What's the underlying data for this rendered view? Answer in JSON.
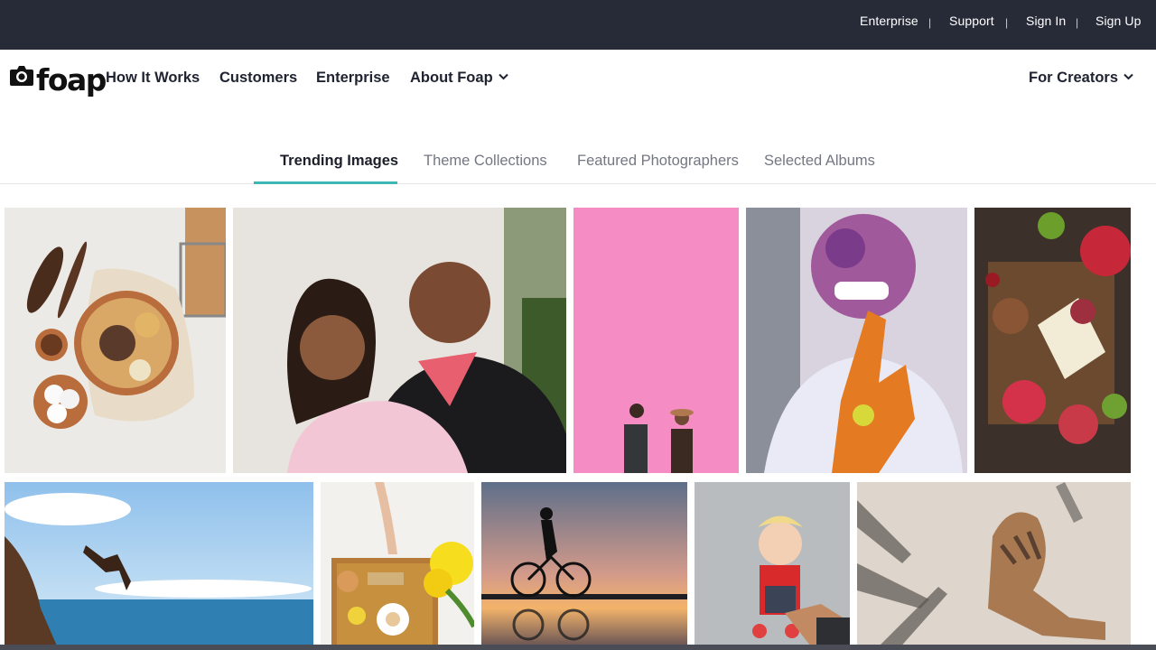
{
  "topbar": {
    "links": [
      "Enterprise",
      "Support",
      "Sign In",
      "Sign Up"
    ],
    "separator": "|"
  },
  "brand": {
    "name": "foap"
  },
  "nav": {
    "items": [
      "How It Works",
      "Customers",
      "Enterprise",
      "About Foap"
    ],
    "right": "For Creators"
  },
  "tabs": {
    "items": [
      "Trending Images",
      "Theme Collections",
      "Featured Photographers",
      "Selected Albums"
    ],
    "active_index": 0
  },
  "photos": [
    {
      "name": "snack-bowl-photo",
      "subject": "snack bowl on white table"
    },
    {
      "name": "couple-portrait-photo",
      "subject": "smiling couple embrace"
    },
    {
      "name": "pink-wall-couple-photo",
      "subject": "couple in front of pink wall"
    },
    {
      "name": "holi-color-face-photo",
      "subject": "person with holi color face"
    },
    {
      "name": "fruit-cheese-board-photo",
      "subject": "fruit and cheese board"
    },
    {
      "name": "cliff-dive-photo",
      "subject": "man diving from cliff into sea"
    },
    {
      "name": "breakfast-tray-photo",
      "subject": "breakfast tray in bed with flowers"
    },
    {
      "name": "sunset-cyclist-photo",
      "subject": "cyclist silhouette at sunset"
    },
    {
      "name": "toddler-hand-photo",
      "subject": "toddler holding hand"
    },
    {
      "name": "palm-shadow-photo",
      "subject": "woman with palm shadows"
    }
  ],
  "colors": {
    "topbar_bg": "#272b38",
    "tab_accent": "#3fb8b5",
    "text_dark": "#1f2230",
    "text_muted": "#747782"
  }
}
